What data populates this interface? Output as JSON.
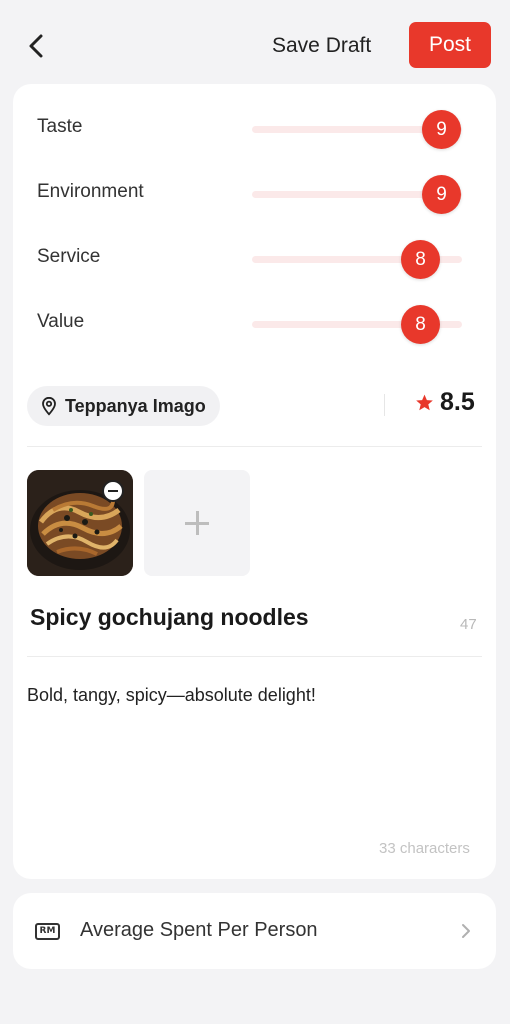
{
  "header": {
    "save_draft_label": "Save Draft",
    "post_label": "Post"
  },
  "ratings": [
    {
      "label": "Taste",
      "value": 9,
      "max": 10
    },
    {
      "label": "Environment",
      "value": 9,
      "max": 10
    },
    {
      "label": "Service",
      "value": 8,
      "max": 10
    },
    {
      "label": "Value",
      "value": 8,
      "max": 10
    }
  ],
  "location": {
    "name": "Teppanya Imago"
  },
  "overall_score": "8.5",
  "post": {
    "title": "Spicy gochujang noodles",
    "title_remaining": "47",
    "description": "Bold, tangy, spicy—absolute delight!",
    "char_count": "33 characters"
  },
  "spent": {
    "icon_text": "RM",
    "label": "Average Spent Per Person"
  },
  "colors": {
    "accent": "#e8382b",
    "track": "#fbe9e9",
    "background": "#f3f3f5"
  }
}
